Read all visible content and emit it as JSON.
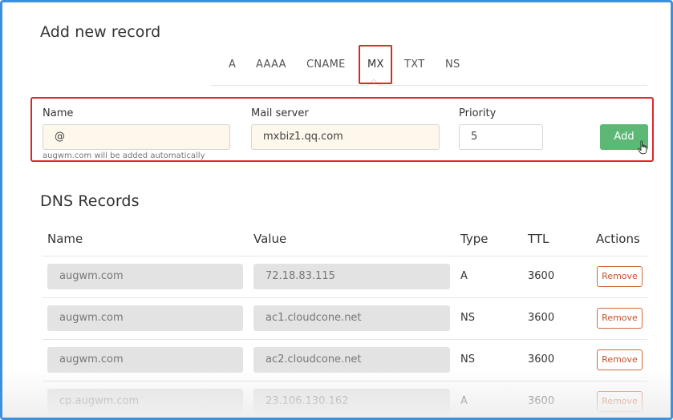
{
  "add_section": {
    "title": "Add new record",
    "tabs": [
      "A",
      "AAAA",
      "CNAME",
      "MX",
      "TXT",
      "NS"
    ],
    "active_tab": "MX"
  },
  "form": {
    "name_label": "Name",
    "name_value": "@",
    "hint": "augwm.com will be added automatically",
    "mail_label": "Mail server",
    "mail_value": "mxbiz1.qq.com",
    "priority_label": "Priority",
    "priority_value": "5",
    "add_label": "Add"
  },
  "dns_section": {
    "title": "DNS Records",
    "columns": [
      "Name",
      "Value",
      "Type",
      "TTL",
      "Actions"
    ],
    "rows": [
      {
        "name": "augwm.com",
        "value": "72.18.83.115",
        "type": "A",
        "ttl": "3600",
        "action": "Remove"
      },
      {
        "name": "augwm.com",
        "value": "ac1.cloudcone.net",
        "type": "NS",
        "ttl": "3600",
        "action": "Remove"
      },
      {
        "name": "augwm.com",
        "value": "ac2.cloudcone.net",
        "type": "NS",
        "ttl": "3600",
        "action": "Remove"
      },
      {
        "name": "cp.augwm.com",
        "value": "23.106.130.162",
        "type": "A",
        "ttl": "3600",
        "action": "Remove"
      }
    ]
  },
  "colors": {
    "highlight": "#e0262b",
    "add_button": "#5cb874",
    "remove_button": "#c5512a",
    "frame": "#3d8fe0"
  },
  "icons": {
    "cursor": "hand-pointer-icon"
  }
}
